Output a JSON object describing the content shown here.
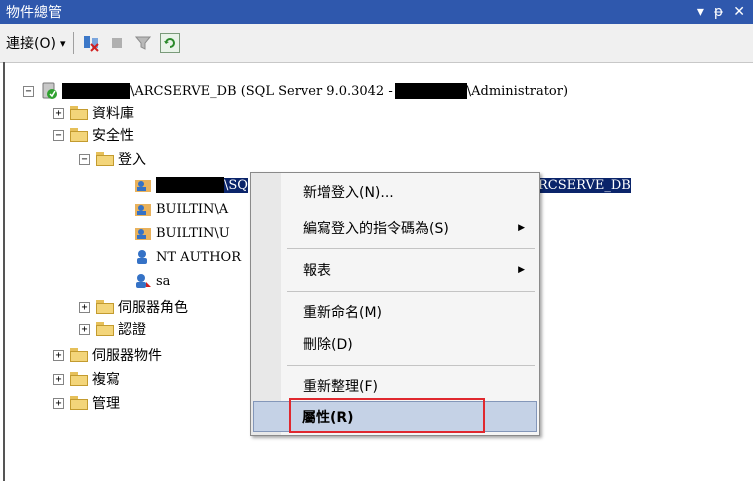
{
  "window": {
    "title": "物件總管",
    "controls": [
      "▾",
      "ᵽ",
      "✕"
    ]
  },
  "toolbar": {
    "connect_label": "連接(O)",
    "connect_arrow": "▾"
  },
  "tree": {
    "root_label_1": "\\ARCSERVE_DB (SQL Server 9.0.3042 -",
    "root_label_2": "\\Administrator)",
    "databases": "資料庫",
    "security": "安全性",
    "logins": "登入",
    "login_selected": "\\SQ",
    "login_selected_tail": "RCSERVE_DB",
    "login_builtin_a": "BUILTIN\\A",
    "login_builtin_u": "BUILTIN\\U",
    "login_nt": "NT AUTHOR",
    "login_sa": "sa",
    "server_roles": "伺服器角色",
    "credentials": "認證",
    "server_objects": "伺服器物件",
    "replication": "複寫",
    "management": "管理"
  },
  "context_menu": {
    "new_login": "新增登入(N)...",
    "script_login": "編寫登入的指令碼為(S)",
    "reports": "報表",
    "rename": "重新命名(M)",
    "delete": "刪除(D)",
    "refresh": "重新整理(F)",
    "properties": "屬性(R)",
    "submenu_arrow": "▶"
  },
  "colors": {
    "titlebar": "#2f58ad",
    "selection": "#0a246a",
    "highlight_box": "#e0282e",
    "menu_hover": "#c5d2e6"
  }
}
